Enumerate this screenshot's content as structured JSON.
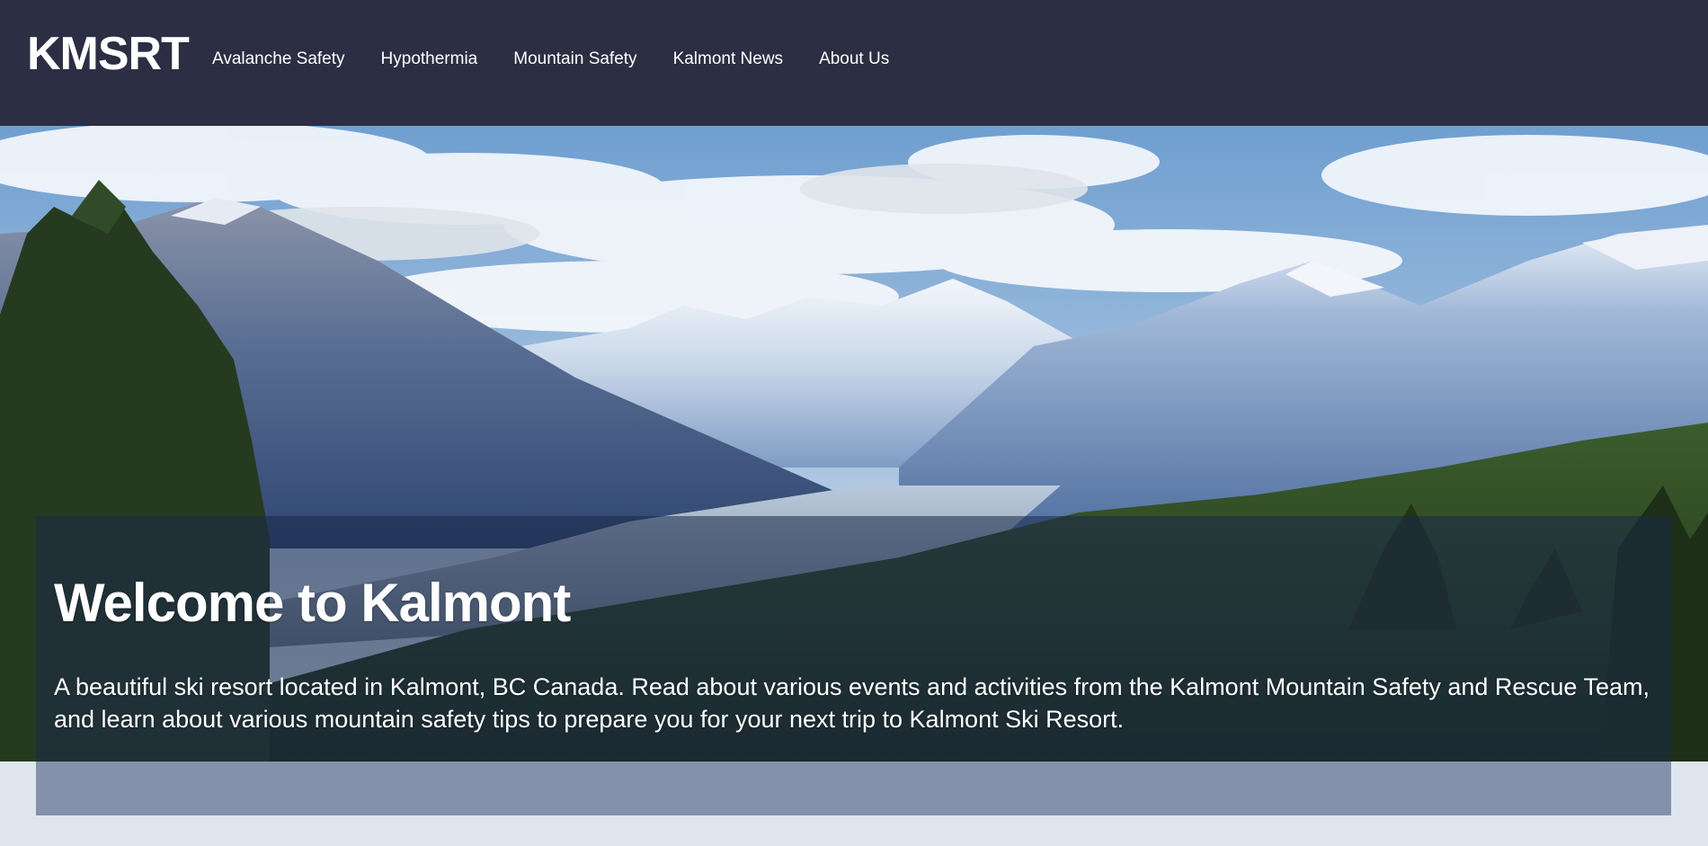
{
  "header": {
    "brand": "KMSRT",
    "nav": [
      {
        "label": "Avalanche Safety"
      },
      {
        "label": "Hypothermia"
      },
      {
        "label": "Mountain Safety"
      },
      {
        "label": "Kalmont News"
      },
      {
        "label": "About Us"
      }
    ]
  },
  "hero": {
    "title": "Welcome to Kalmont",
    "description": "A beautiful ski resort located in Kalmont, BC Canada. Read about various events and activities from the Kalmont Mountain Safety and Rescue Team, and learn about various mountain safety tips to prepare you for your next trip to Kalmont Ski Resort.",
    "image_alt": "mountain-landscape-photo"
  },
  "colors": {
    "header_bg": "#2c2e43",
    "page_bg": "#dfe5ef",
    "panel_lower": "#8392aa",
    "text": "#ffffff"
  }
}
